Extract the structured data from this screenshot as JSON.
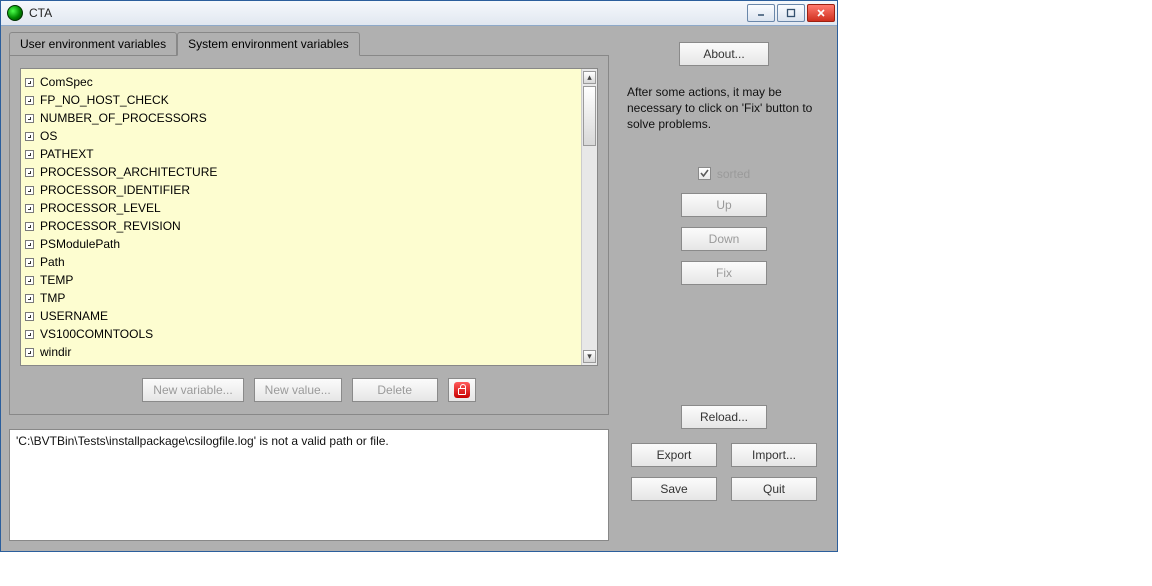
{
  "window": {
    "title": "CTA"
  },
  "tabs": {
    "user": "User environment variables",
    "system": "System environment variables",
    "active": "system"
  },
  "vars": [
    "ComSpec",
    "FP_NO_HOST_CHECK",
    "NUMBER_OF_PROCESSORS",
    "OS",
    "PATHEXT",
    "PROCESSOR_ARCHITECTURE",
    "PROCESSOR_IDENTIFIER",
    "PROCESSOR_LEVEL",
    "PROCESSOR_REVISION",
    "PSModulePath",
    "Path",
    "TEMP",
    "TMP",
    "USERNAME",
    "VS100COMNTOOLS",
    "windir"
  ],
  "buttons": {
    "new_variable": "New variable...",
    "new_value": "New value...",
    "delete": "Delete",
    "about": "About...",
    "up": "Up",
    "down": "Down",
    "fix": "Fix",
    "reload": "Reload...",
    "export": "Export",
    "import": "Import...",
    "save": "Save",
    "quit": "Quit"
  },
  "sorted_label": "sorted",
  "hint": "After some actions, it may be necessary to click on 'Fix' button to solve problems.",
  "log": "'C:\\BVTBin\\Tests\\installpackage\\csilogfile.log' is not a valid path or file."
}
